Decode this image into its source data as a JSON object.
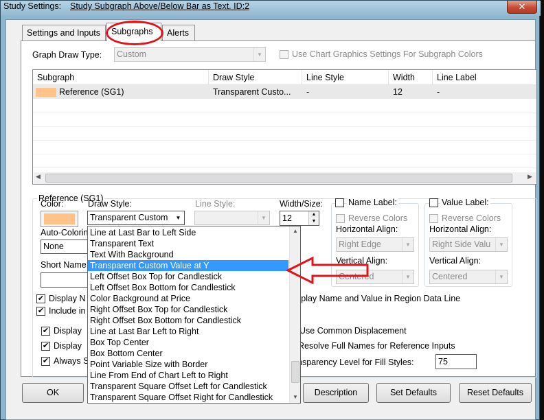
{
  "window": {
    "title_prefix": "Study Settings:",
    "title_name": "Study Subgraph Above/Below Bar as Text. ID:2",
    "close_label": "✕"
  },
  "tabs": [
    {
      "label": "Settings and Inputs"
    },
    {
      "label": "Subgraphs"
    },
    {
      "label": "Alerts"
    }
  ],
  "graph_draw_type": {
    "label": "Graph Draw Type:",
    "value": "Custom",
    "use_chart_graphics_label": "Use Chart Graphics Settings For Subgraph Colors"
  },
  "subgraph_table": {
    "headers": [
      "Subgraph",
      "Draw Style",
      "Line Style",
      "Width",
      "Line Label"
    ],
    "rows": [
      {
        "subgraph": "Reference (SG1)",
        "draw_style": "Transparent Custo...",
        "line_style": "-",
        "width": "12",
        "line_label": "-",
        "color": "#ffc38a"
      }
    ]
  },
  "group": {
    "title": "Reference (SG1)",
    "color_label": "Color:",
    "color_value": "#ffc38a",
    "draw_style_label": "Draw Style:",
    "draw_style_value": "Transparent Custom",
    "line_style_label": "Line Style:",
    "width_size_label": "Width/Size:",
    "width_value": "12",
    "auto_coloring_label": "Auto-Colorin",
    "auto_coloring_value": "None",
    "short_name_label": "Short Name",
    "name_label_label": "Name Label:",
    "value_label_label": "Value Label:",
    "reverse_colors_label": "Reverse Colors",
    "horizontal_align_label": "Horizontal Align:",
    "vertical_align_label": "Vertical Align:",
    "name_h_align": "Right Edge",
    "name_v_align": "Centered",
    "value_h_align": "Right Side Valu",
    "value_v_align": "Centered",
    "display_n_label": "Display N",
    "include_in_label": "Include in",
    "display_name_value_region": "splay Name and Value in Region Data Line"
  },
  "lower_options": {
    "display1": "Display",
    "display2": "Display",
    "always": "Always S",
    "use_common_displacement": "Use Common Displacement",
    "resolve_full_names": "Resolve Full Names for Reference Inputs",
    "transparency_label": "nsparency Level for Fill Styles:",
    "transparency_value": "75"
  },
  "dropdown_options": [
    "Line at Last Bar to Left Side",
    "Transparent Text",
    "Text With Background",
    "Transparent Custom Value at Y",
    "Left Offset Box Top for Candlestick",
    "Left Offset Box Bottom for Candlestick",
    "Color Background at Price",
    "Right Offset Box Top for Candlestick",
    "Right Offset Box Bottom for Candlestick",
    "Line at Last Bar Left to Right",
    "Box Top Center",
    "Box Bottom Center",
    "Point Variable Size with Border",
    "Line From End of Chart Left to Right",
    "Transparent Square Offset Left for Candlestick",
    "Transparent Square Offset Right for Candlestick"
  ],
  "dropdown_selected": "Transparent Custom Value at Y",
  "buttons": {
    "ok": "OK",
    "description": "Description",
    "set_defaults": "Set Defaults",
    "reset_defaults": "Reset Defaults"
  },
  "colors": {
    "annotation_red": "#e2141a",
    "selection_blue": "#3399ff",
    "swatch_orange": "#ffc38a"
  },
  "icons": [
    "close-icon",
    "chevron-down-icon",
    "scroll-left-icon",
    "scroll-right-icon",
    "scroll-up-icon",
    "scroll-down-icon",
    "spin-up-icon",
    "spin-down-icon",
    "checkmark-icon",
    "red-arrow-annotation"
  ]
}
